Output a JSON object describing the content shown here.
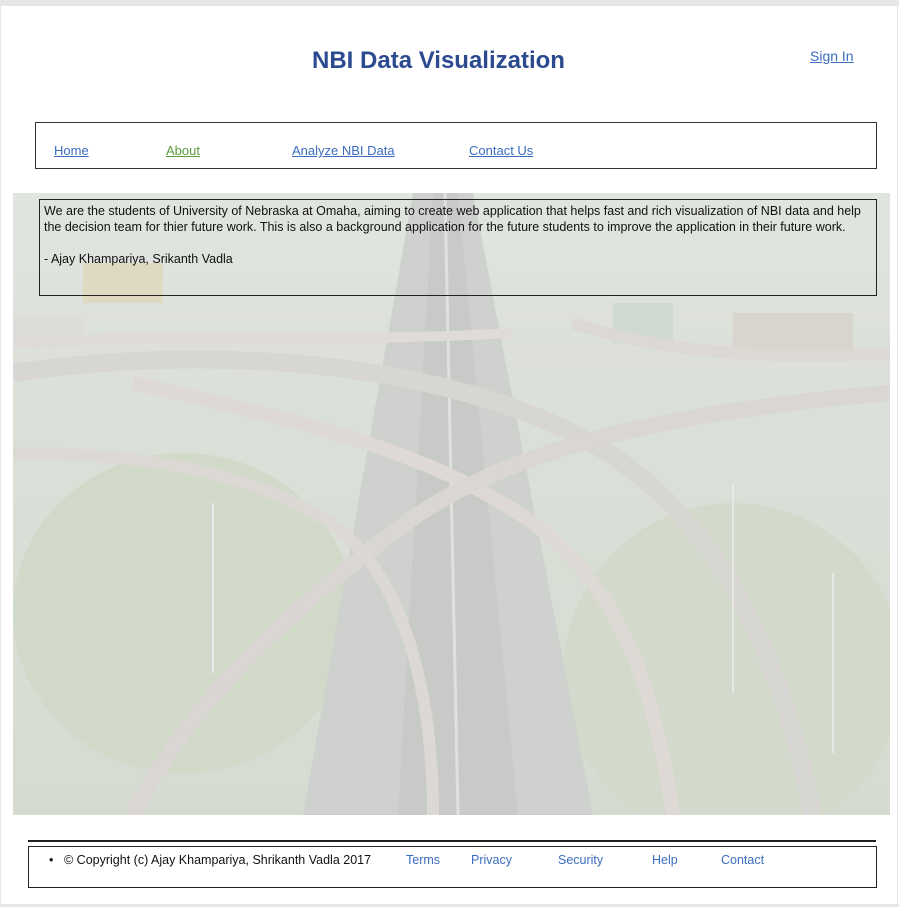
{
  "header": {
    "title": "NBI Data Visualization",
    "sign_in": "Sign In"
  },
  "nav": {
    "items": [
      {
        "label": "Home"
      },
      {
        "label": "About",
        "active": true
      },
      {
        "label": "Analyze NBI Data"
      },
      {
        "label": "Contact Us"
      }
    ]
  },
  "about": {
    "text": "We are the students of University of Nebraska at Omaha, aiming to create web application that helps fast and rich visualization of NBI data and help the decision team for thier future work. This is also a background application for the future students to improve the application in their future work.",
    "signature": "- Ajay Khampariya, Srikanth Vadla"
  },
  "hero": {
    "image": "highway-interchange-aerial-photo"
  },
  "footer": {
    "bullet": "•",
    "copyright": "©  Copyright (c) Ajay Khampariya, Shrikanth Vadla 2017",
    "links": [
      {
        "label": "Terms"
      },
      {
        "label": "Privacy"
      },
      {
        "label": "Security"
      },
      {
        "label": "Help"
      },
      {
        "label": "Contact"
      }
    ]
  },
  "colors": {
    "title": "#2b4a8f",
    "link": "#3a6dbf",
    "active_link": "#5a9a3a"
  }
}
